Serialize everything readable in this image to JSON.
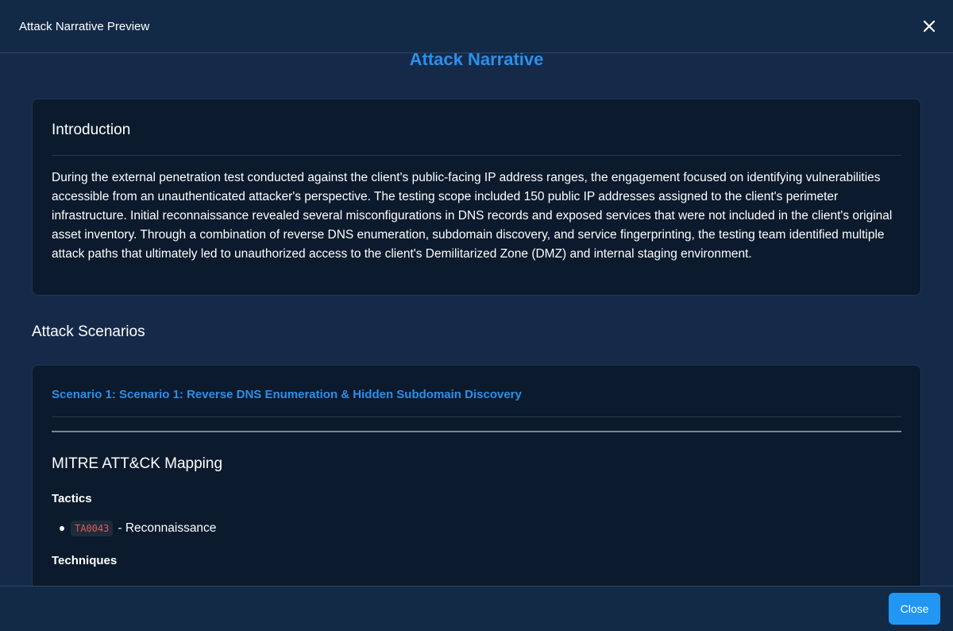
{
  "modal": {
    "title": "Attack Narrative Preview",
    "close_icon": "close-icon",
    "footer_close_label": "Close"
  },
  "document": {
    "title": "Attack Narrative",
    "introduction": {
      "heading": "Introduction",
      "text": "During the external penetration test conducted against the client's public-facing IP address ranges, the engagement focused on identifying vulnerabilities accessible from an unauthenticated attacker's perspective. The testing scope included 150 public IP addresses assigned to the client's perimeter infrastructure. Initial reconnaissance revealed several misconfigurations in DNS records and exposed services that were not included in the client's original asset inventory. Through a combination of reverse DNS enumeration, subdomain discovery, and service fingerprinting, the testing team identified multiple attack paths that ultimately led to unauthorized access to the client's Demilitarized Zone (DMZ) and internal staging environment."
    },
    "scenarios_heading": "Attack Scenarios",
    "scenario": {
      "title": "Scenario 1: Scenario 1: Reverse DNS Enumeration & Hidden Subdomain Discovery",
      "mitre_heading": "MITRE ATT&CK Mapping",
      "tactics_heading": "Tactics",
      "tactics": [
        {
          "code": "TA0043",
          "name": "- Reconnaissance"
        }
      ],
      "techniques_heading": "Techniques"
    }
  },
  "colors": {
    "accent": "#2b8fea",
    "background": "#142a48",
    "card": "#0b1a2c",
    "code_text": "#e05a5a",
    "button": "#2196f3"
  }
}
